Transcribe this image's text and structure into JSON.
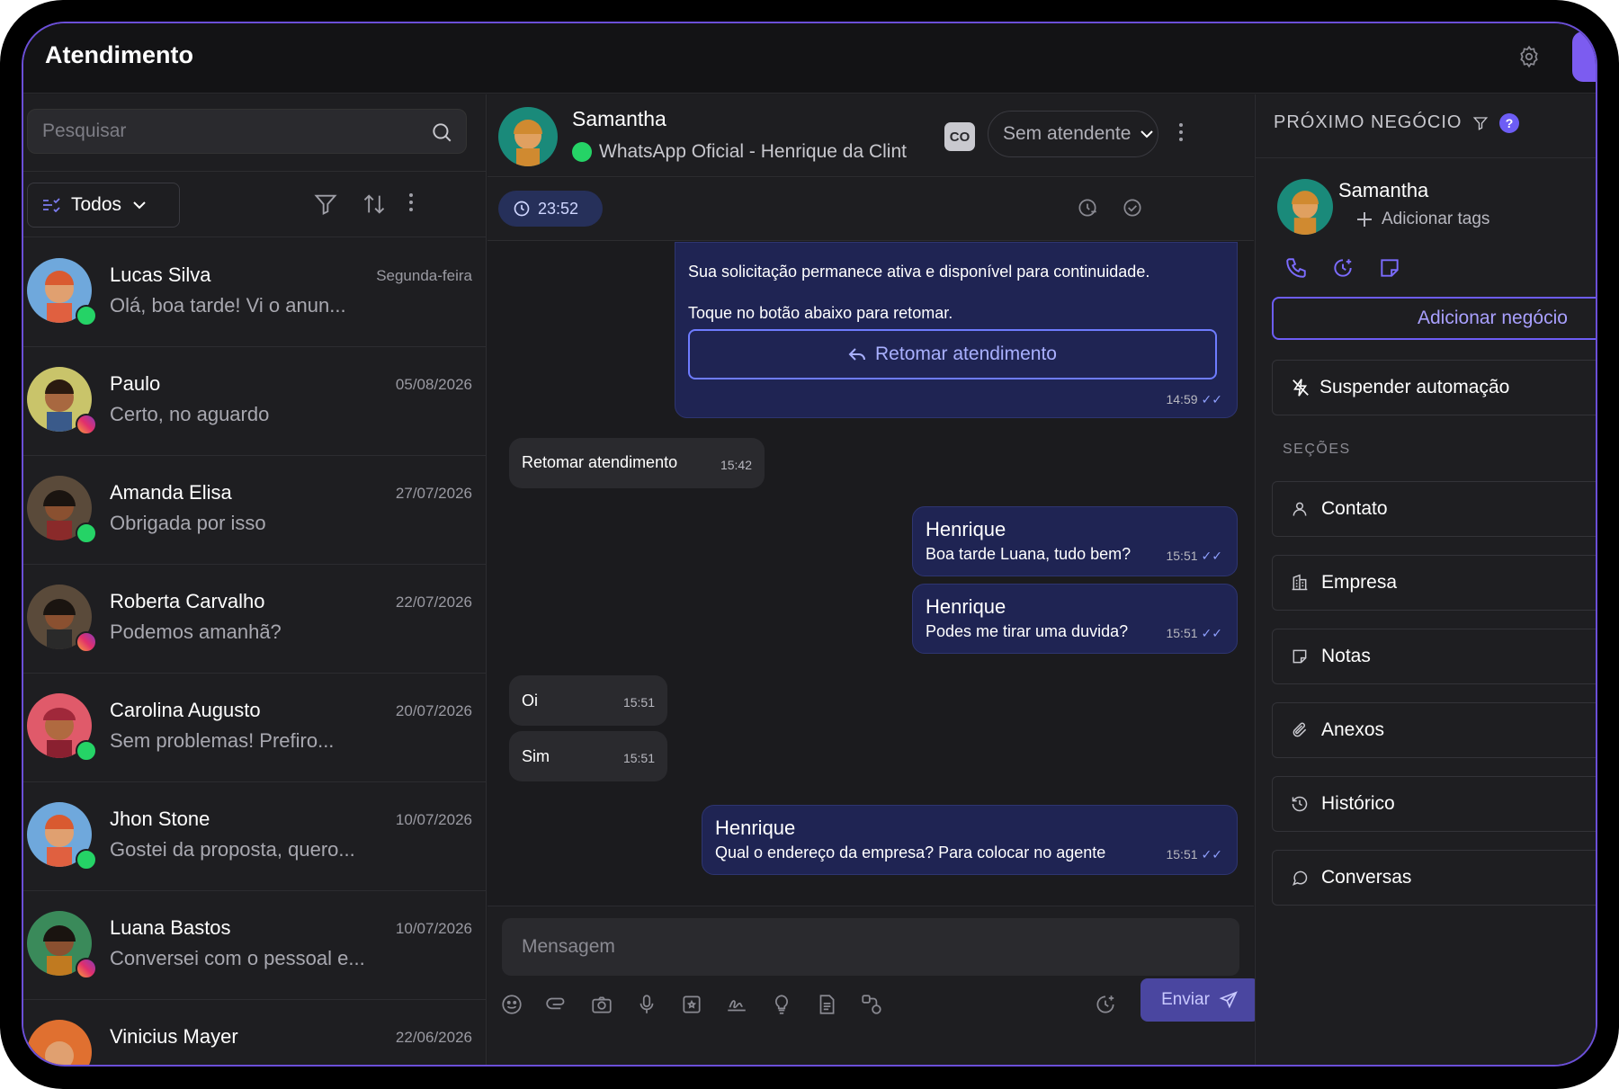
{
  "app": {
    "title": "Atendimento"
  },
  "search": {
    "placeholder": "Pesquisar"
  },
  "filter": {
    "label": "Todos"
  },
  "conversations": [
    {
      "name": "Lucas Silva",
      "date": "Segunda-feira",
      "preview": "Olá, boa tarde! Vi o anun...",
      "channel": "whatsapp"
    },
    {
      "name": "Paulo",
      "date": "05/08/2026",
      "preview": "Certo, no aguardo",
      "channel": "instagram"
    },
    {
      "name": "Amanda Elisa",
      "date": "27/07/2026",
      "preview": "Obrigada por isso",
      "channel": "whatsapp"
    },
    {
      "name": "Roberta Carvalho",
      "date": "22/07/2026",
      "preview": "Podemos amanhã?",
      "channel": "instagram"
    },
    {
      "name": "Carolina Augusto",
      "date": "20/07/2026",
      "preview": "Sem problemas! Prefiro...",
      "channel": "whatsapp"
    },
    {
      "name": "Jhon Stone",
      "date": "10/07/2026",
      "preview": "Gostei da proposta, quero...",
      "channel": "whatsapp"
    },
    {
      "name": "Luana Bastos",
      "date": "10/07/2026",
      "preview": "Conversei com o pessoal e...",
      "channel": "instagram"
    },
    {
      "name": "Vinicius Mayer",
      "date": "22/06/2026",
      "preview": "",
      "channel": "whatsapp"
    }
  ],
  "chat": {
    "contact_name": "Samantha",
    "channel_label": "WhatsApp Oficial - Henrique da Clint",
    "co_badge": "CO",
    "assignee": "Sem atendente",
    "timer": "23:52",
    "messages": {
      "m1_line1": "Sua solicitação permanece ativa e disponível para continuidade.",
      "m1_line2": "Toque no botão abaixo para retomar.",
      "m1_button": "Retomar atendimento",
      "m1_time": "14:59",
      "m2_text": "Retomar atendimento",
      "m2_time": "15:42",
      "m3_sender": "Henrique",
      "m3_text": "Boa tarde Luana, tudo bem?",
      "m3_time": "15:51",
      "m4_sender": "Henrique",
      "m4_text": "Podes me tirar uma duvida?",
      "m4_time": "15:51",
      "m5_text": "Oi",
      "m5_time": "15:51",
      "m6_text": "Sim",
      "m6_time": "15:51",
      "m7_sender": "Henrique",
      "m7_text": "Qual o endereço da empresa? Para colocar no agente",
      "m7_time": "15:51"
    },
    "composer_placeholder": "Mensagem",
    "send_label": "Enviar"
  },
  "sidebar": {
    "heading": "PRÓXIMO NEGÓCIO",
    "help": "?",
    "contact_name": "Samantha",
    "add_tags": "Adicionar tags",
    "add_deal": "Adicionar negócio",
    "suspend": "Suspender automação",
    "sections_label": "SEÇÕES",
    "sections": [
      "Contato",
      "Empresa",
      "Notas",
      "Anexos",
      "Histórico",
      "Conversas"
    ]
  },
  "colors": {
    "accent": "#7c5cf0",
    "outgoing_bubble": "#1f2453",
    "whatsapp": "#25d366"
  }
}
